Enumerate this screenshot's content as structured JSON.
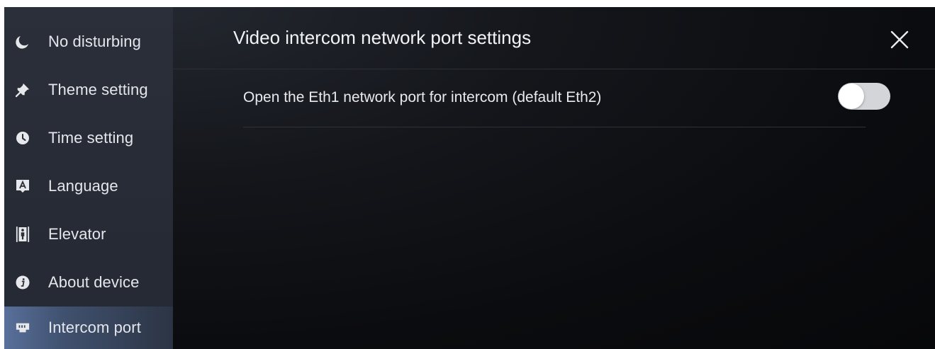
{
  "sidebar": {
    "items": [
      {
        "label": "No disturbing",
        "icon": "moon-icon",
        "active": false
      },
      {
        "label": "Theme setting",
        "icon": "push-pin-icon",
        "active": false
      },
      {
        "label": "Time setting",
        "icon": "clock-icon",
        "active": false
      },
      {
        "label": "Language",
        "icon": "language-icon",
        "active": false
      },
      {
        "label": "Elevator",
        "icon": "elevator-icon",
        "active": false
      },
      {
        "label": "About device",
        "icon": "info-icon",
        "active": false
      },
      {
        "label": "Intercom port",
        "icon": "network-port-icon",
        "active": true
      }
    ]
  },
  "panel": {
    "title": "Video intercom network port settings",
    "close_icon": "close-icon",
    "settings": [
      {
        "label": "Open the Eth1 network port for intercom (default Eth2)",
        "enabled": false
      }
    ]
  },
  "colors": {
    "sidebar_bg": "#2a2e38",
    "active_item": "#59709a",
    "main_bg": "#0b0c0f",
    "text": "#e4e6eb",
    "toggle_off": "#d4d5d9"
  }
}
